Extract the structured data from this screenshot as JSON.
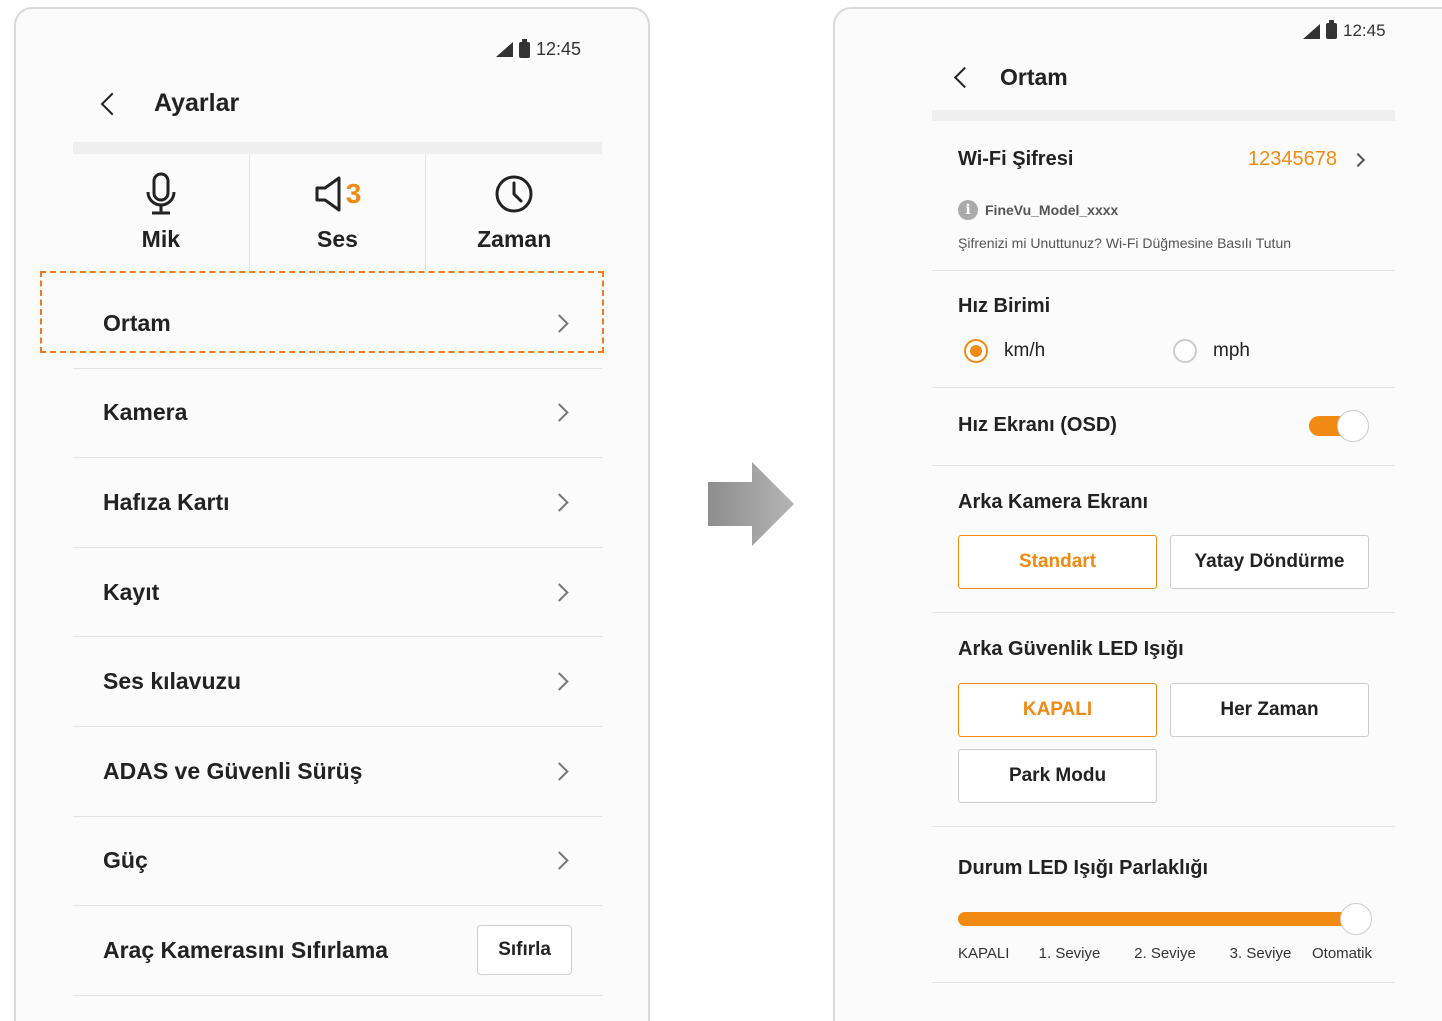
{
  "status": {
    "time": "12:45"
  },
  "left": {
    "title": "Ayarlar",
    "quick": [
      {
        "label": "Mik",
        "icon": "microphone-icon"
      },
      {
        "label": "Ses",
        "icon": "speaker-icon",
        "count": "3"
      },
      {
        "label": "Zaman",
        "icon": "clock-icon"
      }
    ],
    "menu": [
      {
        "label": "Ortam"
      },
      {
        "label": "Kamera"
      },
      {
        "label": "Hafıza Kartı"
      },
      {
        "label": "Kayıt"
      },
      {
        "label": "Ses kılavuzu"
      },
      {
        "label": "ADAS ve Güvenli Sürüş"
      },
      {
        "label": "Güç"
      }
    ],
    "reset": {
      "label": "Araç Kamerasını Sıfırlama",
      "button": "Sıfırla"
    }
  },
  "right": {
    "title": "Ortam",
    "wifi": {
      "label": "Wi-Fi Şifresi",
      "value": "12345678",
      "ssid": "FineVu_Model_xxxx",
      "hint": "Şifrenizi mi Unuttunuz? Wi-Fi Düğmesine Basılı Tutun"
    },
    "speed_unit": {
      "label": "Hız Birimi",
      "options": [
        "km/h",
        "mph"
      ],
      "selected": "km/h"
    },
    "osd": {
      "label": "Hız Ekranı (OSD)",
      "enabled": true
    },
    "rear_cam": {
      "label": "Arka Kamera Ekranı",
      "options": [
        "Standart",
        "Yatay Döndürme"
      ],
      "selected": "Standart"
    },
    "rear_led": {
      "label": "Arka Güvenlik LED Işığı",
      "options": [
        "KAPALI",
        "Her Zaman",
        "Park Modu"
      ],
      "selected": "KAPALI"
    },
    "led_brightness": {
      "label": "Durum LED Işığı Parlaklığı",
      "levels": [
        "KAPALI",
        "1. Seviye",
        "2. Seviye",
        "3. Seviye",
        "Otomatik"
      ],
      "selected": "Otomatik",
      "value_fraction": 1.0
    }
  },
  "colors": {
    "accent": "#f08a12",
    "highlight": "#f07b1e"
  }
}
